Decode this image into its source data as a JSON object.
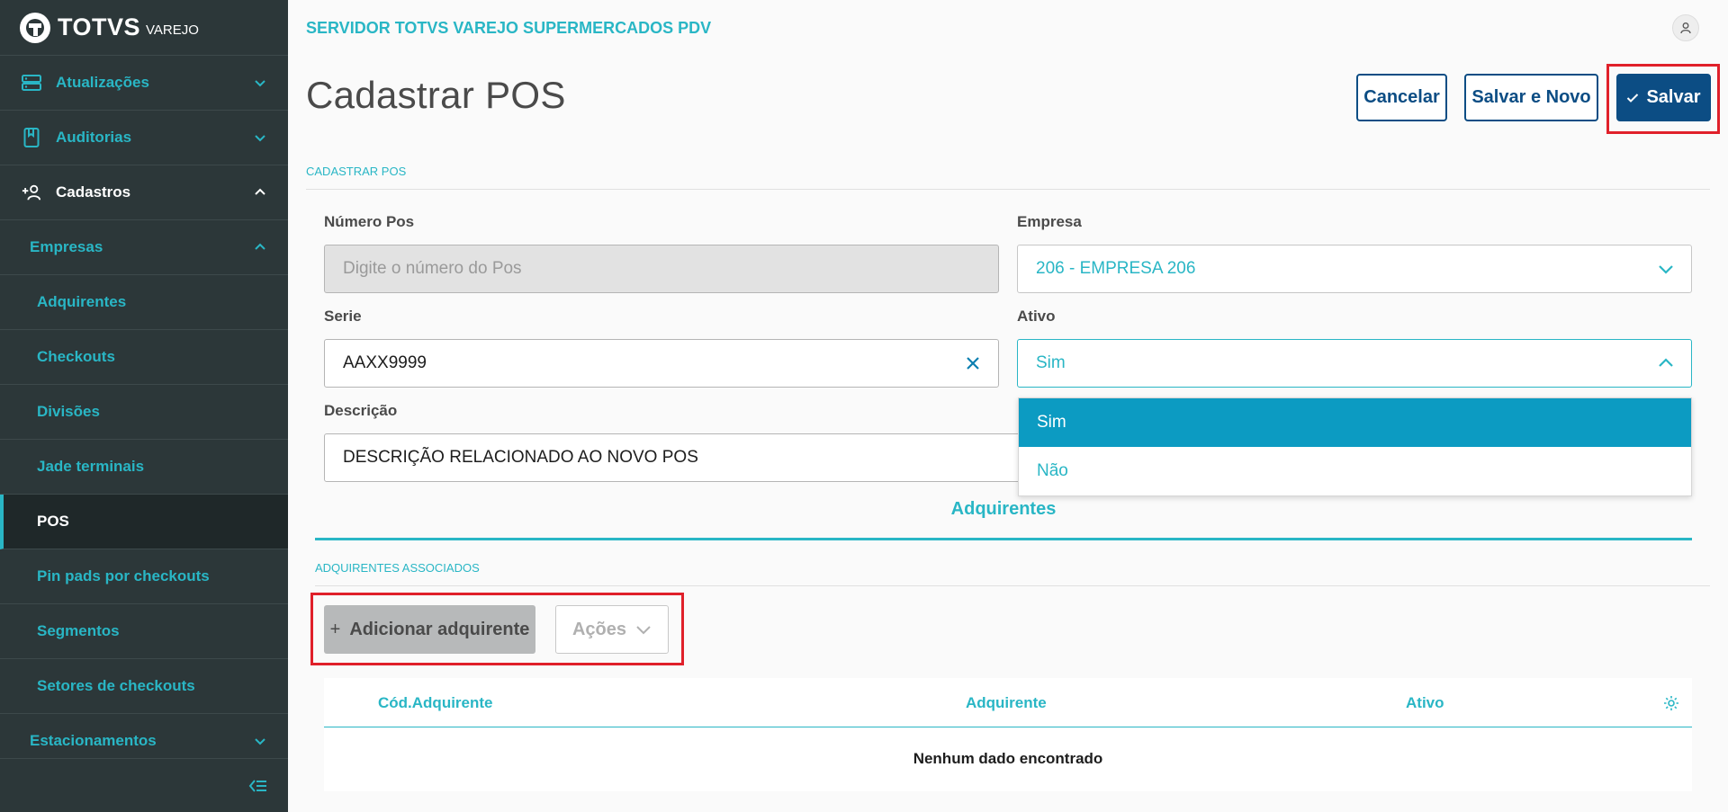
{
  "brand": {
    "name": "TOTVS",
    "sub": "VAREJO"
  },
  "sidebar": {
    "items": [
      {
        "label": "Atualizações",
        "icon": "server-icon"
      },
      {
        "label": "Auditorias",
        "icon": "book-icon"
      },
      {
        "label": "Cadastros",
        "icon": "add-user-icon"
      },
      {
        "label": "Empresas"
      },
      {
        "label": "Adquirentes"
      },
      {
        "label": "Checkouts"
      },
      {
        "label": "Divisões"
      },
      {
        "label": "Jade terminais"
      },
      {
        "label": "POS"
      },
      {
        "label": "Pin pads por checkouts"
      },
      {
        "label": "Segmentos"
      },
      {
        "label": "Setores de checkouts"
      },
      {
        "label": "Estacionamentos"
      }
    ]
  },
  "header": {
    "server_title": "SERVIDOR TOTVS VAREJO SUPERMERCADOS PDV"
  },
  "page": {
    "title": "Cadastrar POS",
    "cancel_label": "Cancelar",
    "save_new_label": "Salvar e Novo",
    "save_label": "Salvar",
    "section_label": "CADASTRAR POS"
  },
  "form": {
    "numero_pos": {
      "label": "Número Pos",
      "placeholder": "Digite o número do Pos",
      "value": ""
    },
    "empresa": {
      "label": "Empresa",
      "value": "206 - EMPRESA 206"
    },
    "serie": {
      "label": "Serie",
      "value": "AAXX9999"
    },
    "ativo": {
      "label": "Ativo",
      "value": "Sim",
      "options": [
        "Sim",
        "Não"
      ]
    },
    "descricao": {
      "label": "Descrição",
      "value": "DESCRIÇÃO RELACIONADO AO NOVO POS"
    }
  },
  "tabs": {
    "adquirentes": "Adquirentes"
  },
  "adquirentes": {
    "section_label": "ADQUIRENTES ASSOCIADOS",
    "add_label": "Adicionar adquirente",
    "actions_label": "Ações",
    "columns": [
      "Cód.Adquirente",
      "Adquirente",
      "Ativo"
    ],
    "empty": "Nenhum dado encontrado"
  },
  "colors": {
    "accent": "#29b6c5",
    "primary": "#0c4d84",
    "sidebar": "#2c3739",
    "highlight": "#e0202a"
  }
}
